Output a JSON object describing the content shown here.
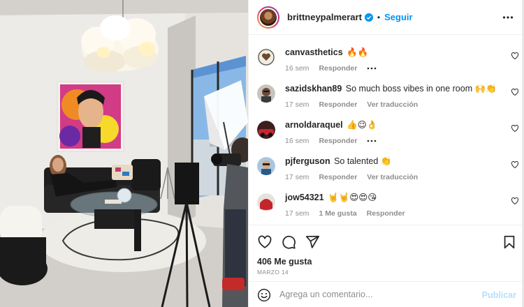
{
  "post": {
    "author": "brittneypalmerart",
    "follow_label": "Seguir",
    "separator": "•"
  },
  "comments": [
    {
      "user": "canvasthetics",
      "text": "🔥🔥",
      "time": "16 sem",
      "likes": "",
      "reply": "Responder",
      "translate": "",
      "has_more": true
    },
    {
      "user": "sazidskhan89",
      "text": "So much boss vibes in one room 🙌👏",
      "time": "17 sem",
      "likes": "",
      "reply": "Responder",
      "translate": "Ver traducción",
      "has_more": false
    },
    {
      "user": "arnoldaraquel",
      "text": "👍😉👌",
      "time": "16 sem",
      "likes": "",
      "reply": "Responder",
      "translate": "",
      "has_more": true
    },
    {
      "user": "pjferguson",
      "text": "So talented 👏",
      "time": "17 sem",
      "likes": "",
      "reply": "Responder",
      "translate": "Ver traducción",
      "has_more": false
    },
    {
      "user": "jow54321",
      "text": "🤘🤘😍😍😘",
      "time": "17 sem",
      "likes": "1 Me gusta",
      "reply": "Responder",
      "translate": "",
      "has_more": false
    }
  ],
  "footer": {
    "likes_count": "406 Me gusta",
    "date": "MARZO 14",
    "comment_placeholder": "Agrega un comentario...",
    "publish_label": "Publicar"
  },
  "icons": {
    "header_more": "more-horizontal-icon",
    "verified": "verified-badge-icon",
    "like": "heart-icon",
    "comment": "comment-icon",
    "share": "share-icon",
    "save": "bookmark-icon",
    "emoji": "emoji-icon"
  },
  "colors": {
    "accent": "#0095f6",
    "publish_disabled": "#b2dffc",
    "muted": "#8e8e8e",
    "text": "#262626"
  }
}
